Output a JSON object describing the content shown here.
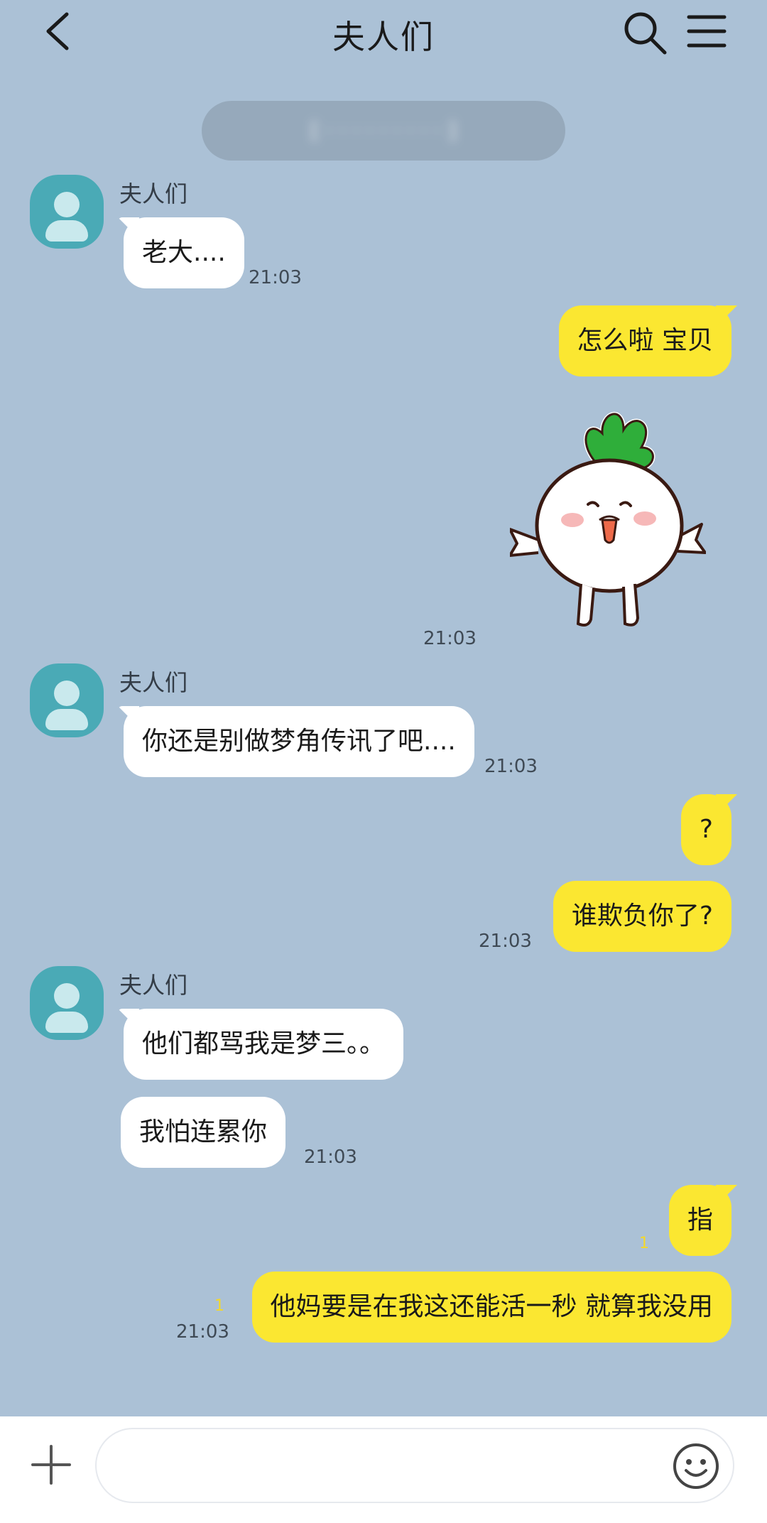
{
  "header": {
    "title": "夫人们",
    "back_icon": "back-arrow-icon",
    "search_icon": "search-icon",
    "menu_icon": "menu-icon"
  },
  "notice": {
    "text": "[ · · · · · · · · · ]"
  },
  "messages": {
    "m1": {
      "sender": "夫人们",
      "text": "老大....",
      "time": "21:03"
    },
    "m2": {
      "text": "怎么啦  宝贝"
    },
    "m3": {
      "sticker": "radish-sticker",
      "time": "21:03"
    },
    "m4": {
      "sender": "夫人们",
      "text": "你还是别做梦角传讯了吧....",
      "time": "21:03"
    },
    "m5": {
      "text": "?"
    },
    "m6": {
      "text": "谁欺负你了?",
      "time": "21:03"
    },
    "m7": {
      "sender": "夫人们",
      "text": "他们都骂我是梦三。。"
    },
    "m8": {
      "text": "我怕连累你",
      "time": "21:03"
    },
    "m9": {
      "text": "指",
      "unread": "1"
    },
    "m10": {
      "text": "他妈要是在我这还能活一秒  就算我没用",
      "unread": "1",
      "time": "21:03"
    }
  },
  "input": {
    "placeholder": "",
    "plus_icon": "plus-icon",
    "emoji_icon": "emoji-icon"
  },
  "colors": {
    "background": "#abc1d6",
    "outgoing_bubble": "#fbe731",
    "incoming_bubble": "#ffffff",
    "avatar": "#4aaab6",
    "unread": "#f4d82a"
  }
}
